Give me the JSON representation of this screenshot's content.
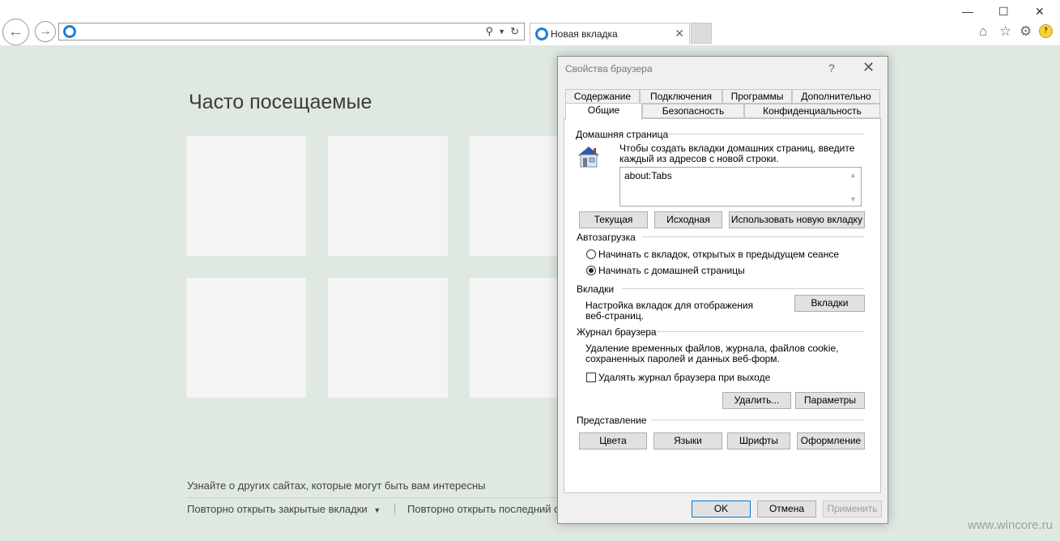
{
  "browser": {
    "address_value": "",
    "tab_title": "Новая вкладка",
    "icons": [
      "back-icon",
      "forward-icon",
      "ie-icon",
      "search-icon",
      "refresh-icon",
      "home-icon",
      "favorites-icon",
      "settings-icon",
      "smiley-icon"
    ]
  },
  "newtab": {
    "heading": "Часто посещаемые",
    "discover": "Узнайте о других сайтах, которые могут быть вам интересны",
    "reopen_tabs": "Повторно открыть закрытые вкладки",
    "reopen_last": "Повторно открыть последний с"
  },
  "watermark": "www.wincore.ru",
  "dialog": {
    "title": "Свойства браузера",
    "help": "?",
    "tabs_top": [
      "Содержание",
      "Подключения",
      "Программы",
      "Дополнительно"
    ],
    "tabs_bottom": [
      "Общие",
      "Безопасность",
      "Конфиденциальность"
    ],
    "home": {
      "label": "Домашняя страница",
      "desc_line1": "Чтобы создать вкладки домашних страниц, введите",
      "desc_line2": "каждый из адресов с новой строки.",
      "value": "about:Tabs",
      "btn_current": "Текущая",
      "btn_default": "Исходная",
      "btn_newtab": "Использовать новую вкладку"
    },
    "startup": {
      "label": "Автозагрузка",
      "opt1": "Начинать с вкладок, открытых в предыдущем сеансе",
      "opt2": "Начинать с домашней страницы",
      "selected": "opt2"
    },
    "tabs_group": {
      "label": "Вкладки",
      "desc_line1": "Настройка вкладок для отображения",
      "desc_line2": "веб-страниц.",
      "btn": "Вкладки"
    },
    "history": {
      "label": "Журнал браузера",
      "desc_line1": "Удаление временных файлов, журнала, файлов cookie,",
      "desc_line2": "сохраненных паролей и данных веб-форм.",
      "checkbox": "Удалять журнал браузера при выходе",
      "checked": false,
      "btn_delete": "Удалить...",
      "btn_params": "Параметры"
    },
    "appearance": {
      "label": "Представление",
      "btn_colors": "Цвета",
      "btn_languages": "Языки",
      "btn_fonts": "Шрифты",
      "btn_design": "Оформление"
    },
    "footer": {
      "ok": "OK",
      "cancel": "Отмена",
      "apply": "Применить"
    }
  }
}
